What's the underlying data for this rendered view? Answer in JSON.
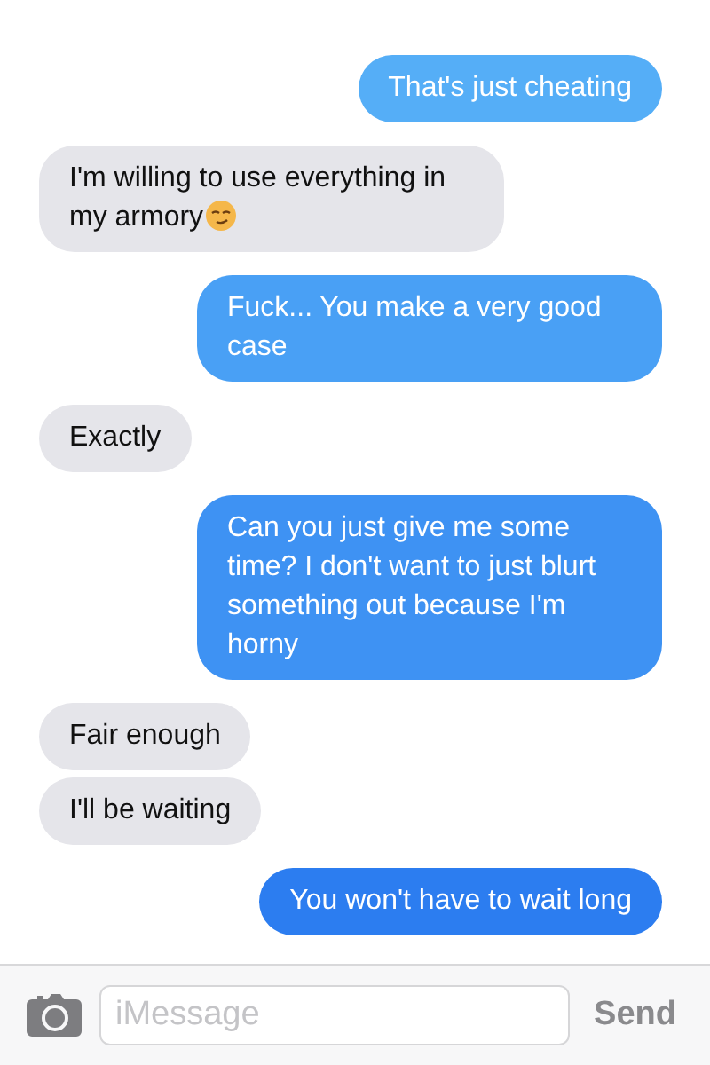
{
  "messages": [
    {
      "kind": "sent",
      "text": "That's just cheating"
    },
    {
      "kind": "received",
      "parts": [
        {
          "kind": "text",
          "text": "I'm willing to use everything in my armory"
        },
        {
          "kind": "emoji"
        }
      ]
    },
    {
      "kind": "sent",
      "text": "Fuck... You make a very good case"
    },
    {
      "kind": "received",
      "text": "Exactly"
    },
    {
      "kind": "sent",
      "text": "Can you just give me some time? I don't want to just blurt something out because I'm horny"
    },
    {
      "kind": "received",
      "text": "Fair enough"
    },
    {
      "kind": "received",
      "text": "I'll be waiting"
    },
    {
      "kind": "sent",
      "text": "You won't have to wait long"
    }
  ],
  "composer": {
    "placeholder": "iMessage",
    "send_label": "Send"
  }
}
